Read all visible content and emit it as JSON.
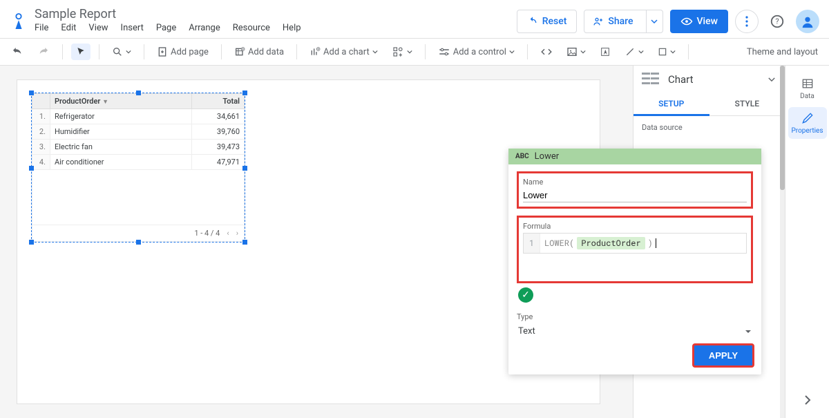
{
  "header": {
    "doc_title": "Sample Report",
    "menu": [
      "File",
      "Edit",
      "View",
      "Insert",
      "Page",
      "Arrange",
      "Resource",
      "Help"
    ],
    "reset_label": "Reset",
    "share_label": "Share",
    "view_label": "View"
  },
  "toolbar": {
    "add_page": "Add page",
    "add_data": "Add data",
    "add_chart": "Add a chart",
    "add_control": "Add a control",
    "theme_layout": "Theme and layout"
  },
  "chart_data": {
    "type": "table",
    "columns": [
      "ProductOrder",
      "Total"
    ],
    "rows": [
      {
        "idx": "1.",
        "product": "Refrigerator",
        "total": "34,661"
      },
      {
        "idx": "2.",
        "product": "Humidifier",
        "total": "39,760"
      },
      {
        "idx": "3.",
        "product": "Electric fan",
        "total": "39,473"
      },
      {
        "idx": "4.",
        "product": "Air conditioner",
        "total": "47,971"
      }
    ],
    "footer_range": "1 - 4 / 4"
  },
  "panel": {
    "title": "Chart",
    "tab_setup": "SETUP",
    "tab_style": "STYLE",
    "section_data_source": "Data source"
  },
  "rail": {
    "data": "Data",
    "properties": "Properties"
  },
  "popup": {
    "bar_abc": "ABC",
    "bar_name": "Lower",
    "name_label": "Name",
    "name_value": "Lower",
    "formula_label": "Formula",
    "gutter_1": "1",
    "fn_open": "LOWER(",
    "field_token": "ProductOrder",
    "fn_close": ")",
    "type_label": "Type",
    "type_value": "Text",
    "apply_label": "APPLY"
  }
}
